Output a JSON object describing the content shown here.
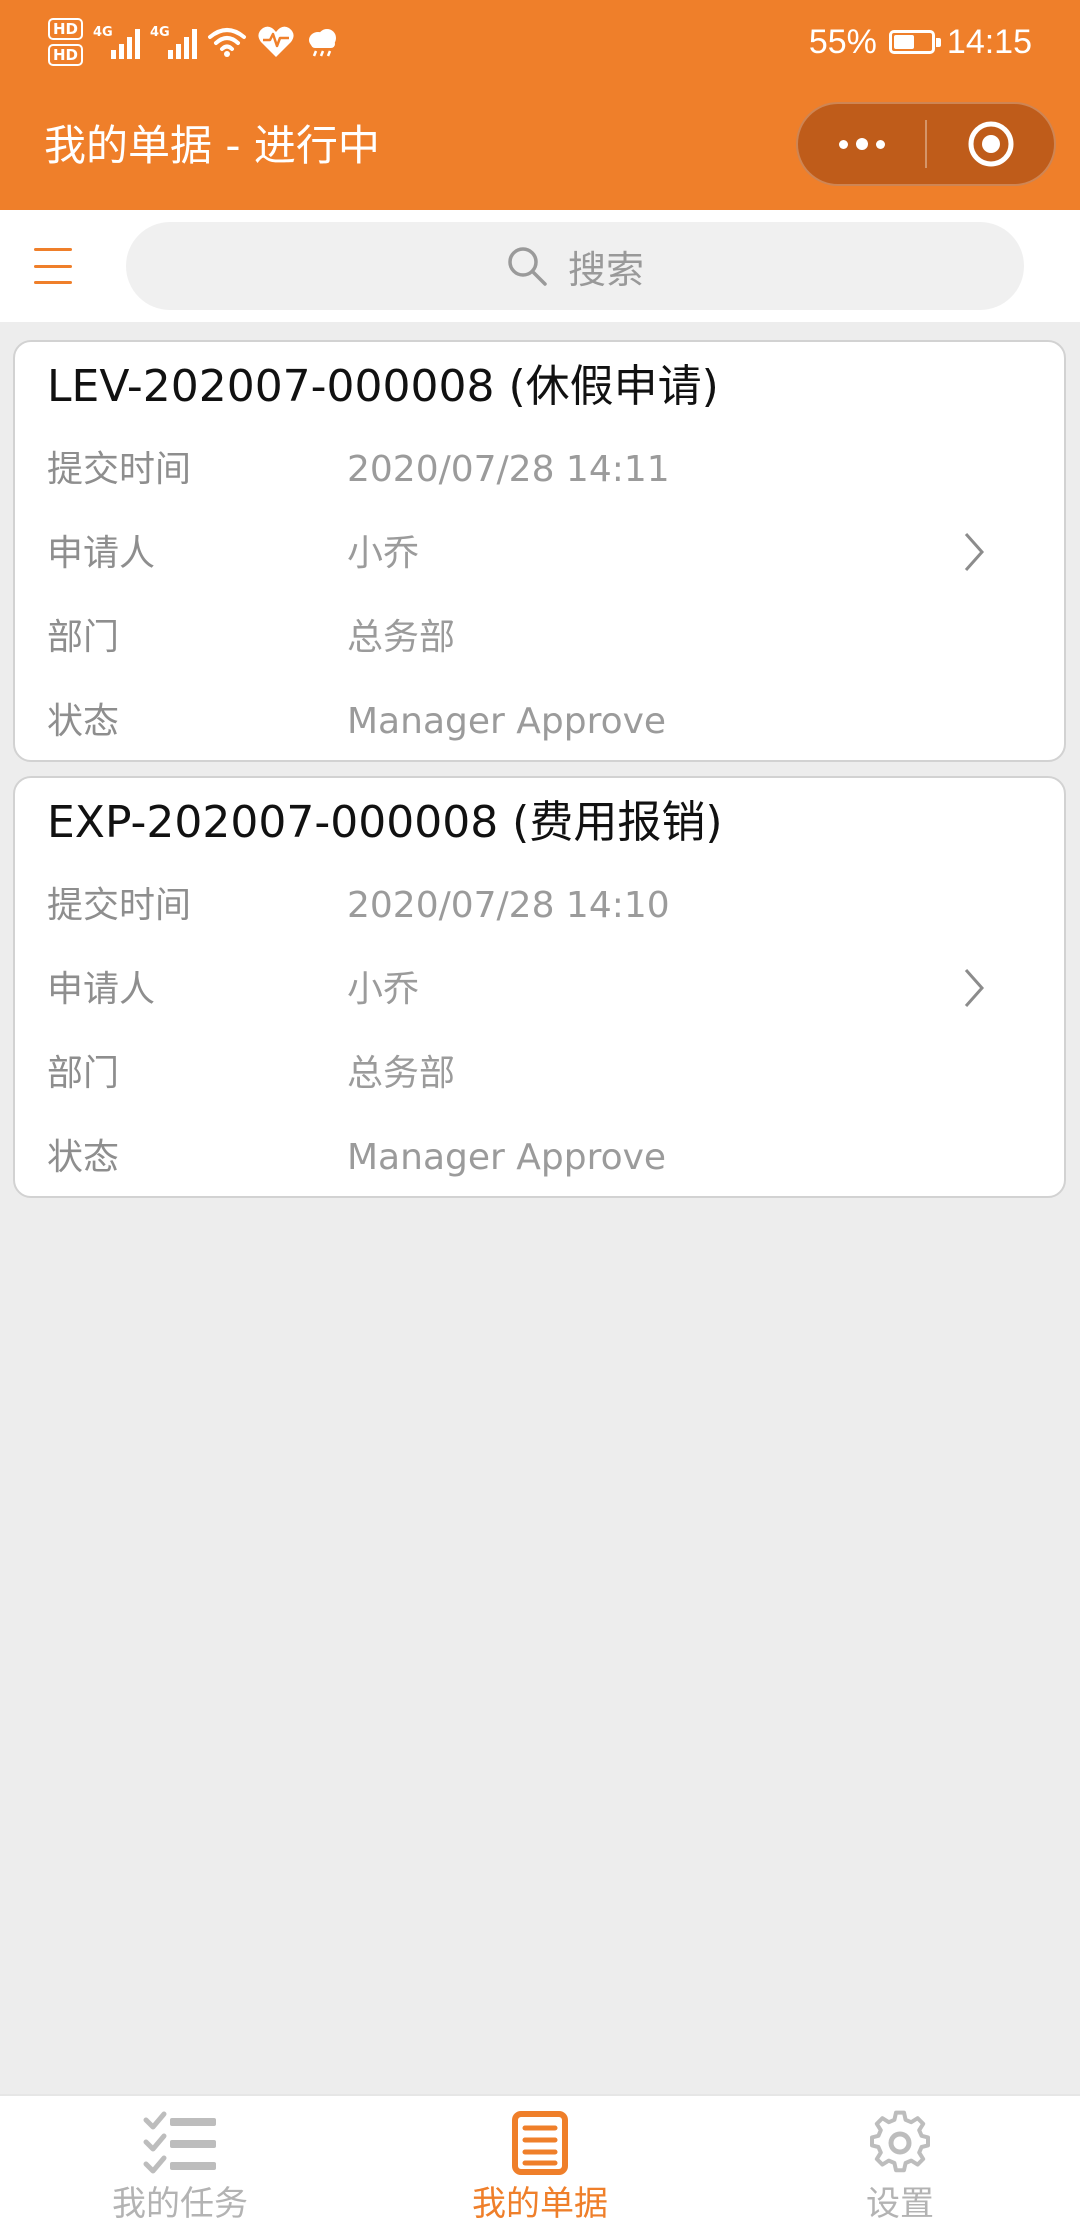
{
  "status_bar": {
    "hd1": "HD",
    "hd2": "HD",
    "sim1_network": "4G",
    "sim2_network": "4G",
    "icons": [
      "signal-icon",
      "signal-icon",
      "wifi-icon",
      "health-icon",
      "weather-cloud-icon"
    ],
    "battery_percent": "55%",
    "battery_level": 0.55,
    "time": "14:15"
  },
  "header": {
    "title": "我的单据 - 进行中",
    "accent_color": "#ef7f2a",
    "capsule_color": "#bf5c1a"
  },
  "search": {
    "placeholder": "搜索"
  },
  "cards": [
    {
      "title": "LEV-202007-000008 (休假申请)",
      "fields": [
        {
          "label": "提交时间",
          "value": "2020/07/28 14:11"
        },
        {
          "label": "申请人",
          "value": "小乔"
        },
        {
          "label": "部门",
          "value": "总务部"
        },
        {
          "label": "状态",
          "value": "Manager Approve"
        }
      ]
    },
    {
      "title": "EXP-202007-000008 (费用报销)",
      "fields": [
        {
          "label": "提交时间",
          "value": "2020/07/28 14:10"
        },
        {
          "label": "申请人",
          "value": "小乔"
        },
        {
          "label": "部门",
          "value": "总务部"
        },
        {
          "label": "状态",
          "value": "Manager Approve"
        }
      ]
    }
  ],
  "tabs": [
    {
      "label": "我的任务",
      "icon": "task-list-icon",
      "active": false
    },
    {
      "label": "我的单据",
      "icon": "document-icon",
      "active": true
    },
    {
      "label": "设置",
      "icon": "gear-icon",
      "active": false
    }
  ]
}
